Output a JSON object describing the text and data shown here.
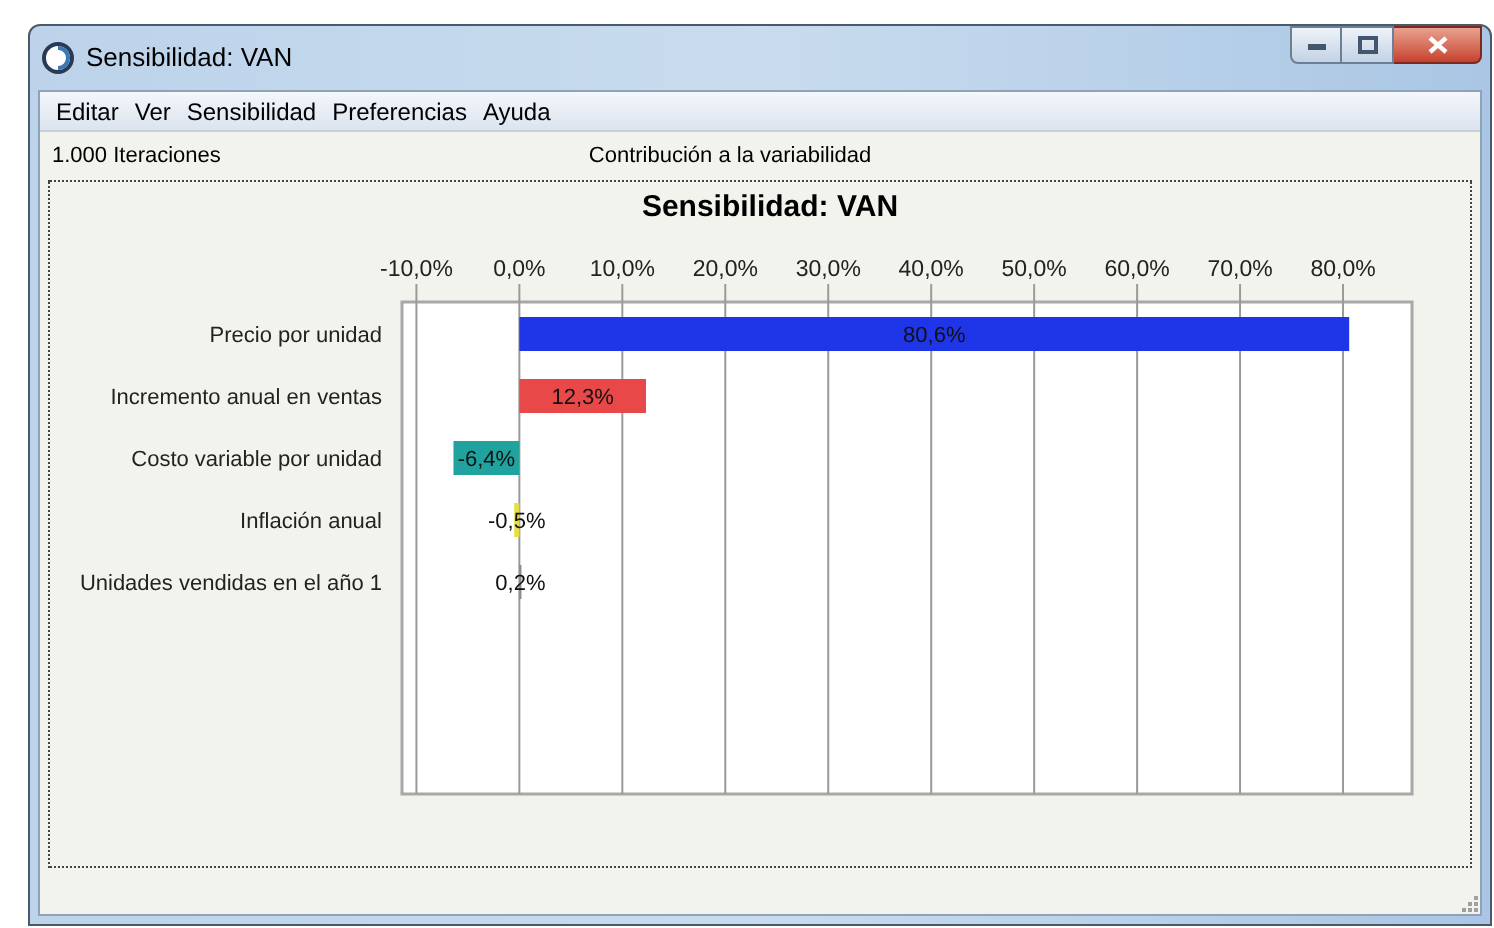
{
  "window": {
    "title": "Sensibilidad: VAN"
  },
  "menu": [
    "Editar",
    "Ver",
    "Sensibilidad",
    "Preferencias",
    "Ayuda"
  ],
  "info": {
    "iterations": "1.000 Iteraciones",
    "subtitle": "Contribución a la variabilidad"
  },
  "chart_data": {
    "type": "bar",
    "orientation": "horizontal",
    "title": "Sensibilidad: VAN",
    "categories": [
      "Precio por unidad",
      "Incremento anual en ventas",
      "Costo variable por unidad",
      "Inflación anual",
      "Unidades vendidas en el año 1"
    ],
    "series": [
      {
        "color": "#1f35e8",
        "values": [
          80.6,
          null,
          null,
          null,
          null
        ]
      },
      {
        "color": "#e84848",
        "values": [
          null,
          12.3,
          null,
          null,
          null
        ]
      },
      {
        "color": "#20a39e",
        "values": [
          null,
          null,
          -6.4,
          null,
          null
        ]
      },
      {
        "color": "#e6e040",
        "values": [
          null,
          null,
          null,
          -0.5,
          null
        ]
      },
      {
        "color": "#8a8a8a",
        "values": [
          null,
          null,
          null,
          null,
          0.2
        ]
      }
    ],
    "value_labels": [
      "80,6%",
      "12,3%",
      "-6,4%",
      "-0,5%",
      "0,2%"
    ],
    "xlim": [
      -11.4,
      86.7
    ],
    "grid": true,
    "xticks": [
      {
        "value": -10,
        "label": "-10,0%"
      },
      {
        "value": 0,
        "label": "0,0%"
      },
      {
        "value": 10,
        "label": "10,0%"
      },
      {
        "value": 20,
        "label": "20,0%"
      },
      {
        "value": 30,
        "label": "30,0%"
      },
      {
        "value": 40,
        "label": "40,0%"
      },
      {
        "value": 50,
        "label": "50,0%"
      },
      {
        "value": 60,
        "label": "60,0%"
      },
      {
        "value": 70,
        "label": "70,0%"
      },
      {
        "value": 80,
        "label": "80,0%"
      }
    ]
  }
}
